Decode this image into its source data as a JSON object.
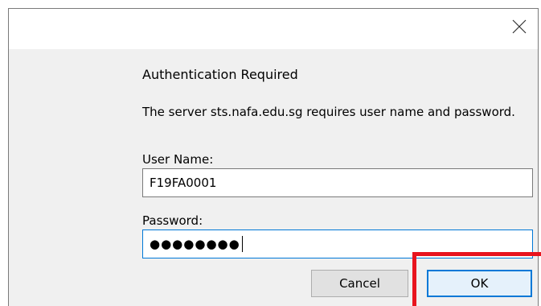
{
  "dialog": {
    "heading": "Authentication Required",
    "message": "The server sts.nafa.edu.sg requires user name and password.",
    "close_icon": "close-icon"
  },
  "form": {
    "username_label": "User Name:",
    "username_value": "F19FA0001",
    "password_label": "Password:",
    "password_mask": "●●●●●●●●"
  },
  "buttons": {
    "cancel_label": "Cancel",
    "ok_label": "OK"
  },
  "colors": {
    "accent": "#0078d7",
    "highlight": "#e8141e",
    "dialog_bg": "#f0f0f0"
  }
}
